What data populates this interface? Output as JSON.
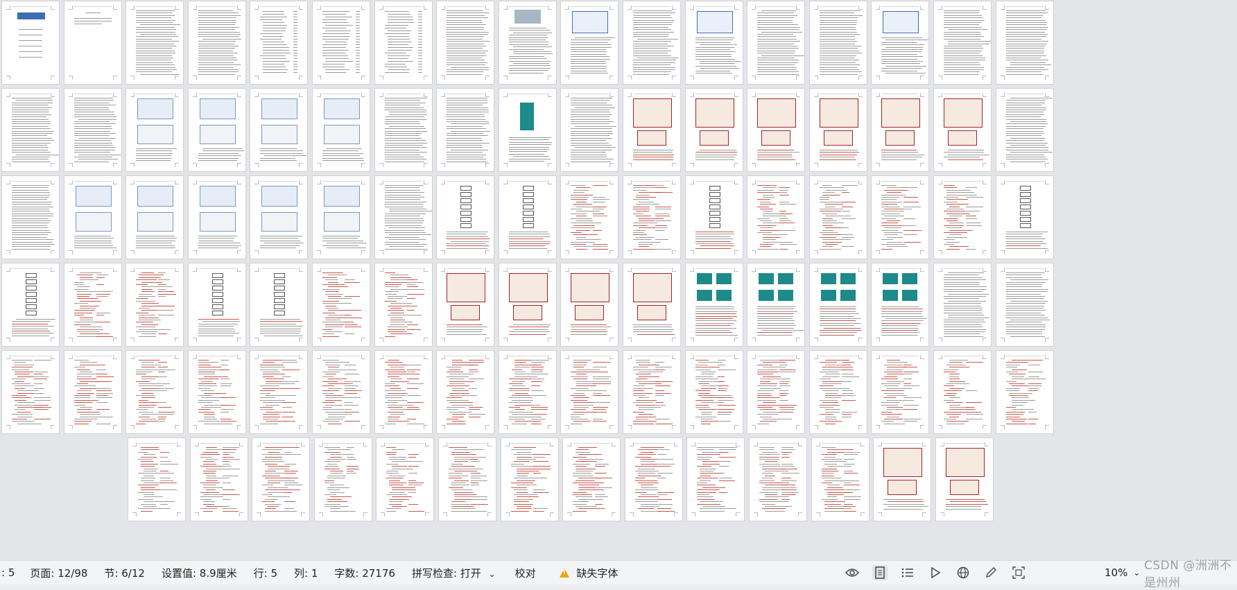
{
  "statusbar": {
    "page_prefix": ": 5",
    "page": "页面: 12/98",
    "section": "节: 6/12",
    "setting": "设置值: 8.9厘米",
    "line": "行: 5",
    "column": "列: 1",
    "word_count": "字数: 27176",
    "spell_check": "拼写检查: 打开",
    "proofread": "校对",
    "missing_fonts": "缺失字体",
    "zoom": "10%",
    "watermark": "CSDN @洲洲不是州州"
  },
  "icons": {
    "spell_dropdown": "chevron-down-icon",
    "missing_fonts": "warning-icon",
    "reading_mode": "eye-icon",
    "page_view": "page-view-icon",
    "outline": "outline-icon",
    "play": "play-icon",
    "web": "globe-icon",
    "pen": "pen-icon",
    "fit": "fit-screen-icon"
  },
  "colors": {
    "canvas": "#e3e5e8",
    "page": "#ffffff",
    "statusbar": "#f3f4f6",
    "figure_red": "#a0232a",
    "figure_teal": "#1e8a8a",
    "figure_blue": "#3a6fb5",
    "warning": "#f0a500"
  },
  "document": {
    "page_types": [
      [
        "cover",
        "blank",
        "text",
        "text",
        "toc",
        "toc",
        "toc",
        "text",
        "photo",
        "diagram",
        "text",
        "diagram",
        "text",
        "text",
        "diagram",
        "text",
        "text"
      ],
      [
        "text",
        "text",
        "screens",
        "screens",
        "screens",
        "screens",
        "text",
        "text",
        "chip",
        "text",
        "schem",
        "schem",
        "schem",
        "schem",
        "schem",
        "schem",
        "text"
      ],
      [
        "text",
        "screens",
        "screens",
        "screens",
        "screens",
        "screens",
        "text",
        "flow",
        "flow",
        "code",
        "code",
        "flow",
        "code",
        "code",
        "code",
        "code",
        "flow"
      ],
      [
        "flow",
        "code",
        "code",
        "flow",
        "flow",
        "code",
        "code",
        "schem",
        "schem",
        "schem",
        "schem",
        "lcd",
        "lcd",
        "lcd",
        "lcd",
        "text",
        "text"
      ],
      [
        "code",
        "code",
        "code",
        "code",
        "code",
        "code",
        "code",
        "code",
        "code",
        "code",
        "code",
        "code",
        "code",
        "code",
        "code",
        "code",
        "code"
      ],
      [
        "code",
        "code",
        "code",
        "code",
        "code",
        "code",
        "code",
        "code",
        "code",
        "code",
        "code",
        "code",
        "schem",
        "schem"
      ]
    ]
  }
}
